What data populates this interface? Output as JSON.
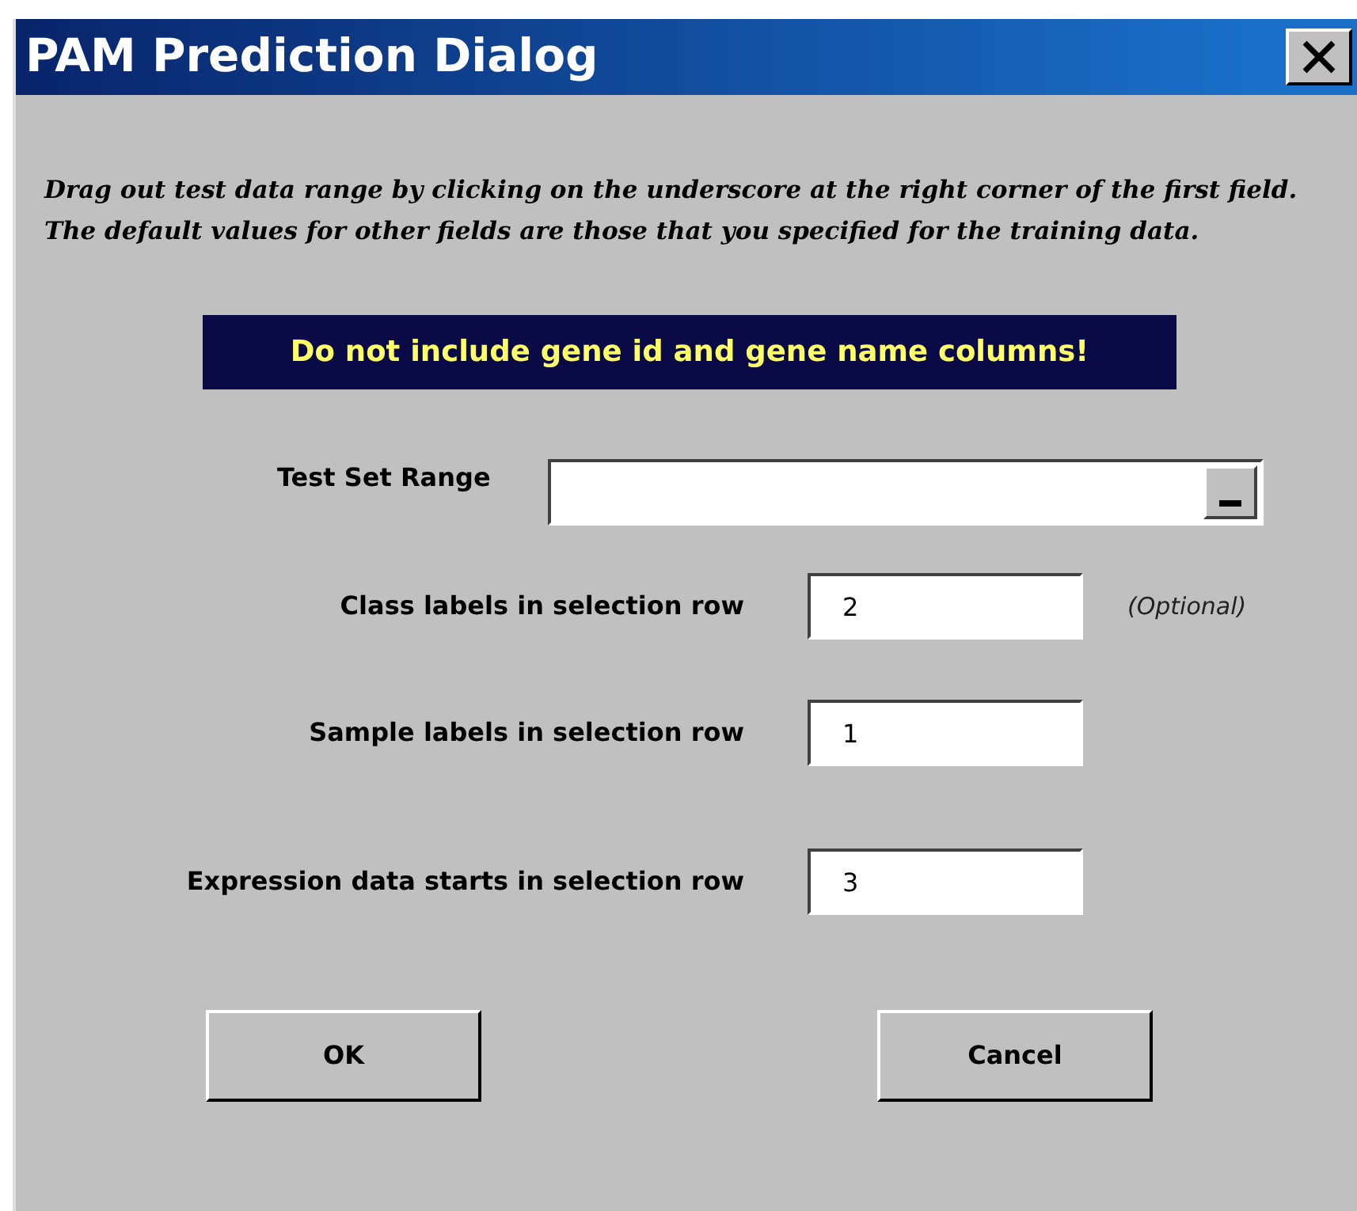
{
  "window": {
    "title": "PAM Prediction Dialog"
  },
  "instructions": "Drag out test data range by clicking on the underscore at the right corner of the first field. The default values for other fields are those that you specified for the training data.",
  "warning": "Do not include gene id and gene name columns!",
  "fields": [
    {
      "kind": "range",
      "label": "Test Set Range"
    },
    {
      "kind": "number",
      "label": "Class labels in selection row",
      "value": "2",
      "note": "(Optional)"
    },
    {
      "kind": "number",
      "label": "Sample labels in selection row",
      "value": "1"
    },
    {
      "kind": "number",
      "label": "Expression data starts in selection row",
      "value": "3"
    }
  ],
  "buttons": [
    "OK",
    "Cancel"
  ]
}
